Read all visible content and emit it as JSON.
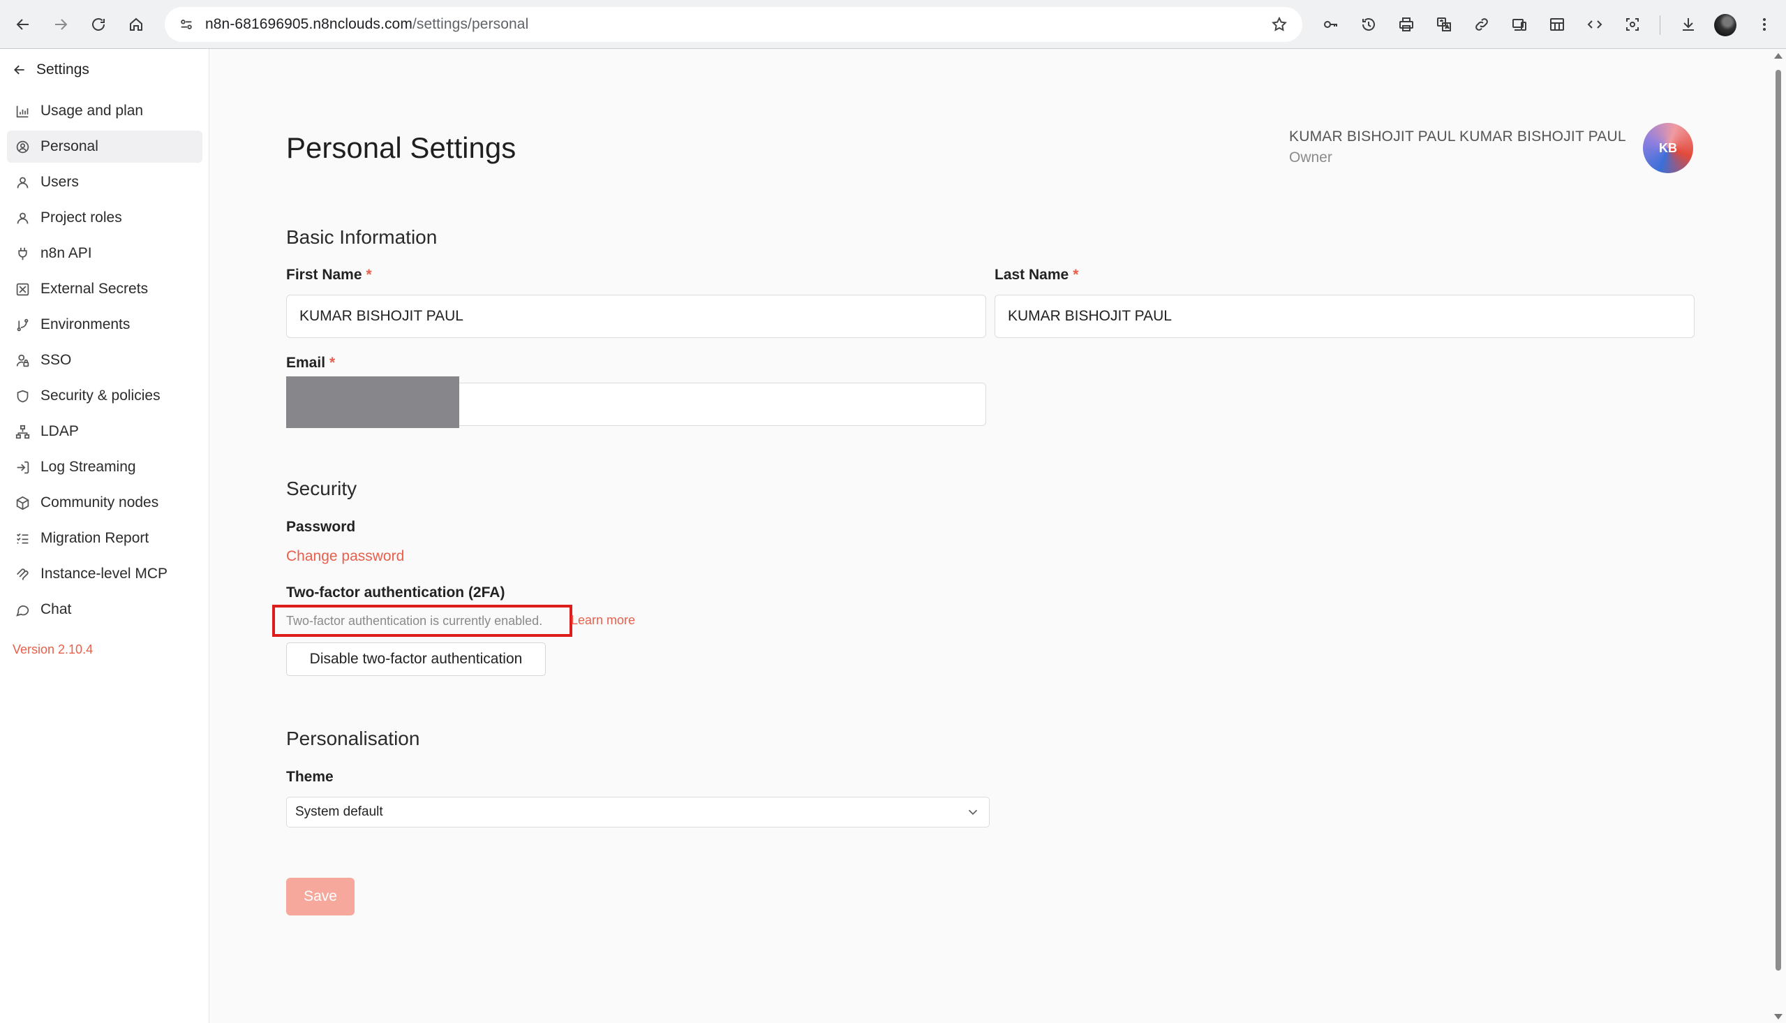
{
  "browser": {
    "url_host": "n8n-681696905.n8nclouds.com",
    "url_path": "/settings/personal"
  },
  "sidebar": {
    "back_label": "Settings",
    "items": [
      {
        "label": "Usage and plan",
        "icon": "bar-chart-icon"
      },
      {
        "label": "Personal",
        "icon": "user-circle-icon",
        "active": true
      },
      {
        "label": "Users",
        "icon": "user-icon"
      },
      {
        "label": "Project roles",
        "icon": "user-icon"
      },
      {
        "label": "n8n API",
        "icon": "plug-icon"
      },
      {
        "label": "External Secrets",
        "icon": "vault-icon"
      },
      {
        "label": "Environments",
        "icon": "git-branch-icon"
      },
      {
        "label": "SSO",
        "icon": "user-lock-icon"
      },
      {
        "label": "Security & policies",
        "icon": "shield-icon"
      },
      {
        "label": "LDAP",
        "icon": "network-icon"
      },
      {
        "label": "Log Streaming",
        "icon": "log-in-icon"
      },
      {
        "label": "Community nodes",
        "icon": "box-icon"
      },
      {
        "label": "Migration Report",
        "icon": "list-checks-icon"
      },
      {
        "label": "Instance-level MCP",
        "icon": "mcp-icon"
      },
      {
        "label": "Chat",
        "icon": "chat-bubble-icon"
      }
    ],
    "version": "Version 2.10.4"
  },
  "header": {
    "title": "Personal Settings",
    "user_name": "KUMAR BISHOJIT PAUL KUMAR BISHOJIT PAUL",
    "user_role": "Owner",
    "avatar_initials": "KB"
  },
  "basic_info": {
    "section_title": "Basic Information",
    "first_name_label": "First Name",
    "first_name_value": "KUMAR BISHOJIT PAUL",
    "last_name_label": "Last Name",
    "last_name_value": "KUMAR BISHOJIT PAUL",
    "email_label": "Email",
    "required_marker": "*"
  },
  "security": {
    "section_title": "Security",
    "password_label": "Password",
    "change_password_link": "Change password",
    "twofa_label": "Two-factor authentication (2FA)",
    "twofa_status": "Two-factor authentication is currently enabled.",
    "learn_more_link": "Learn more",
    "disable_button": "Disable two-factor authentication"
  },
  "personalisation": {
    "section_title": "Personalisation",
    "theme_label": "Theme",
    "theme_value": "System default"
  },
  "actions": {
    "save_label": "Save"
  },
  "colors": {
    "accent": "#e8604c",
    "save_disabled": "#f6a89c",
    "highlight_box": "#dd1c1c"
  }
}
